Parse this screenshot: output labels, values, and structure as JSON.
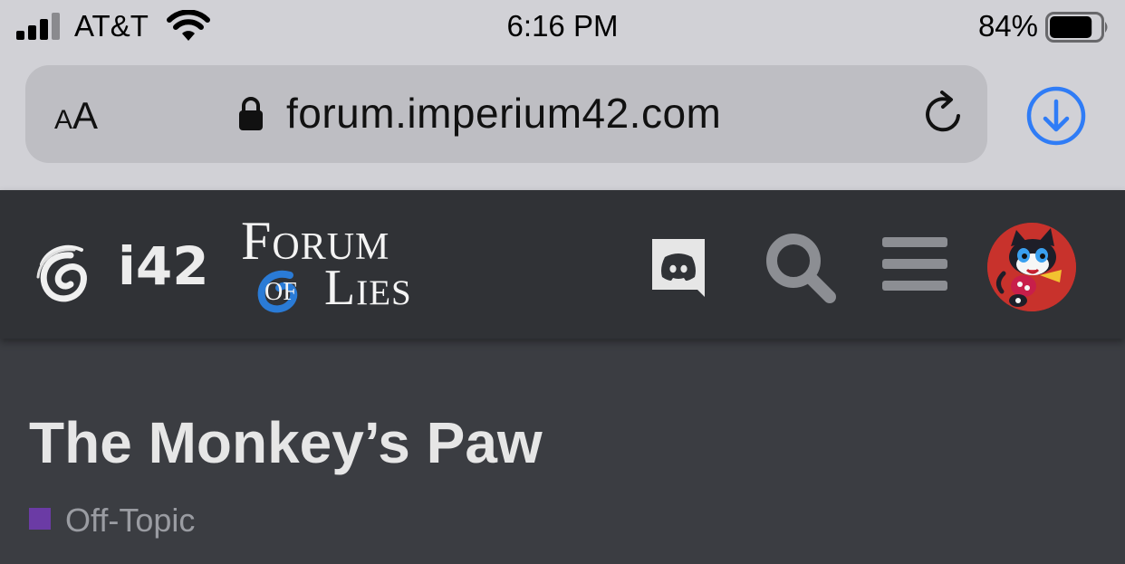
{
  "status_bar": {
    "carrier": "AT&T",
    "time": "6:16 PM",
    "battery_percent": "84%",
    "battery_level": 0.84,
    "signal_bars": 3,
    "icons": [
      "signal-icon",
      "wifi-icon",
      "battery-icon"
    ]
  },
  "browser": {
    "text_size_small": "A",
    "text_size_big": "A",
    "url": "forum.imperium42.com",
    "icons": [
      "lock-icon",
      "reload-icon",
      "download-icon"
    ],
    "accent_color": "#2f7cf6"
  },
  "site_header": {
    "logo_text": "i42",
    "forum_logo": {
      "line1": "Forum",
      "line2_of": "of",
      "line2_lies": "Lies"
    },
    "buttons": [
      "discord-icon",
      "search-icon",
      "hamburger-menu-icon",
      "user-avatar"
    ],
    "colors": {
      "header_bg": "#303236",
      "page_bg": "#3b3d42",
      "logo_blue": "#2a7bd6",
      "avatar_bg": "#c8322c"
    }
  },
  "topic": {
    "title": "The Monkey’s Paw",
    "category": {
      "label": "Off-Topic",
      "color": "#6b3ba5"
    }
  }
}
